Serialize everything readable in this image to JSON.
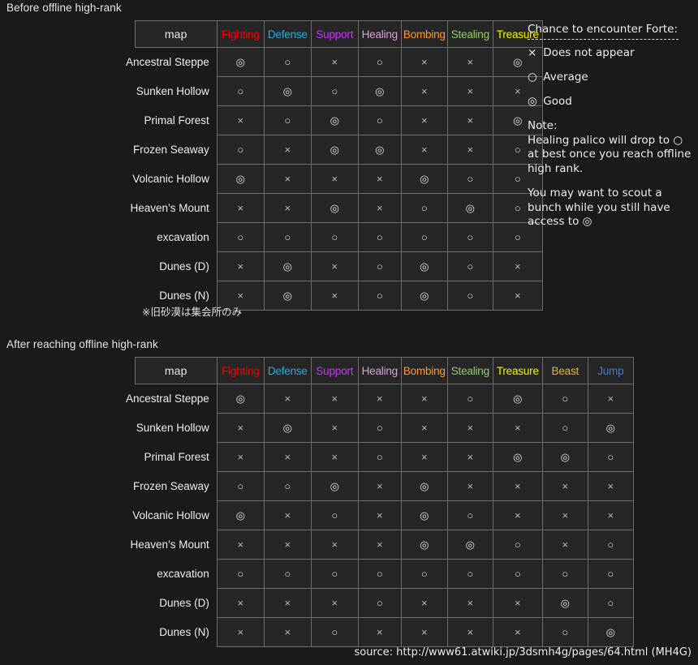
{
  "titles": {
    "before": "Before offline high-rank",
    "after": "After reaching offline high-rank"
  },
  "symbols": {
    "none": "×",
    "average": "○",
    "good": "◎"
  },
  "table_before": {
    "map_header": "map",
    "columns": [
      {
        "label": "Fighting",
        "color": "#ff0000"
      },
      {
        "label": "Defense",
        "color": "#29abe2"
      },
      {
        "label": "Support",
        "color": "#cc33ff"
      },
      {
        "label": "Healing",
        "color": "#d9a0d9"
      },
      {
        "label": "Bombing",
        "color": "#ff9933"
      },
      {
        "label": "Stealing",
        "color": "#8fd164"
      },
      {
        "label": "Treasure",
        "color": "#f5f500"
      }
    ],
    "rows": [
      {
        "map": "Ancestral Steppe",
        "values": [
          "◎",
          "○",
          "×",
          "○",
          "×",
          "×",
          "◎"
        ]
      },
      {
        "map": "Sunken Hollow",
        "values": [
          "○",
          "◎",
          "○",
          "◎",
          "×",
          "×",
          "×"
        ]
      },
      {
        "map": "Primal Forest",
        "values": [
          "×",
          "○",
          "◎",
          "○",
          "×",
          "×",
          "◎"
        ]
      },
      {
        "map": "Frozen Seaway",
        "values": [
          "○",
          "×",
          "◎",
          "◎",
          "×",
          "×",
          "○"
        ]
      },
      {
        "map": "Volcanic Hollow",
        "values": [
          "◎",
          "×",
          "×",
          "×",
          "◎",
          "○",
          "○"
        ]
      },
      {
        "map": "Heaven’s Mount",
        "values": [
          "×",
          "×",
          "◎",
          "×",
          "○",
          "◎",
          "○"
        ]
      },
      {
        "map": "excavation",
        "values": [
          "○",
          "○",
          "○",
          "○",
          "○",
          "○",
          "○"
        ]
      },
      {
        "map": "Dunes (D)",
        "values": [
          "×",
          "◎",
          "×",
          "○",
          "◎",
          "○",
          "×"
        ]
      },
      {
        "map": "Dunes (N)",
        "values": [
          "×",
          "◎",
          "×",
          "○",
          "◎",
          "○",
          "×"
        ]
      }
    ],
    "footnote": "※旧砂漠は集会所のみ"
  },
  "table_after": {
    "map_header": "map",
    "columns": [
      {
        "label": "Fighting",
        "color": "#ff0000"
      },
      {
        "label": "Defense",
        "color": "#29abe2"
      },
      {
        "label": "Support",
        "color": "#cc33ff"
      },
      {
        "label": "Healing",
        "color": "#d9a0d9"
      },
      {
        "label": "Bombing",
        "color": "#ff9933"
      },
      {
        "label": "Stealing",
        "color": "#8fd164"
      },
      {
        "label": "Treasure",
        "color": "#f5f500"
      },
      {
        "label": "Beast",
        "color": "#e8b33c"
      },
      {
        "label": "Jump",
        "color": "#3a7fd5"
      }
    ],
    "rows": [
      {
        "map": "Ancestral Steppe",
        "values": [
          "◎",
          "×",
          "×",
          "×",
          "×",
          "○",
          "◎",
          "○",
          "×"
        ]
      },
      {
        "map": "Sunken Hollow",
        "values": [
          "×",
          "◎",
          "×",
          "○",
          "×",
          "×",
          "×",
          "○",
          "◎"
        ]
      },
      {
        "map": "Primal Forest",
        "values": [
          "×",
          "×",
          "×",
          "○",
          "×",
          "×",
          "◎",
          "◎",
          "○"
        ]
      },
      {
        "map": "Frozen Seaway",
        "values": [
          "○",
          "○",
          "◎",
          "×",
          "◎",
          "×",
          "×",
          "×",
          "×"
        ]
      },
      {
        "map": "Volcanic Hollow",
        "values": [
          "◎",
          "×",
          "○",
          "×",
          "◎",
          "○",
          "×",
          "×",
          "×"
        ]
      },
      {
        "map": "Heaven’s Mount",
        "values": [
          "×",
          "×",
          "×",
          "×",
          "◎",
          "◎",
          "○",
          "×",
          "○"
        ]
      },
      {
        "map": "excavation",
        "values": [
          "○",
          "○",
          "○",
          "○",
          "○",
          "○",
          "○",
          "○",
          "○"
        ]
      },
      {
        "map": "Dunes (D)",
        "values": [
          "×",
          "×",
          "×",
          "○",
          "×",
          "×",
          "×",
          "◎",
          "○"
        ]
      },
      {
        "map": "Dunes (N)",
        "values": [
          "×",
          "×",
          "○",
          "×",
          "×",
          "×",
          "×",
          "○",
          "◎"
        ]
      }
    ]
  },
  "legend": {
    "title": "Chance to encounter Forte:",
    "entries": [
      {
        "symbol": "×",
        "label": "Does not appear"
      },
      {
        "symbol": "○",
        "label": "Average"
      },
      {
        "symbol": "◎",
        "label": "Good"
      }
    ],
    "note_heading": "Note:",
    "note_lines": [
      "Healing palico will drop to ○",
      "at best once you reach offline",
      "high rank."
    ],
    "note_lines2": [
      "You may want to scout a",
      "bunch while you still have",
      "access to ◎"
    ]
  },
  "source": "source:  http://www61.atwiki.jp/3dsmh4g/pages/64.html  (MH4G)"
}
